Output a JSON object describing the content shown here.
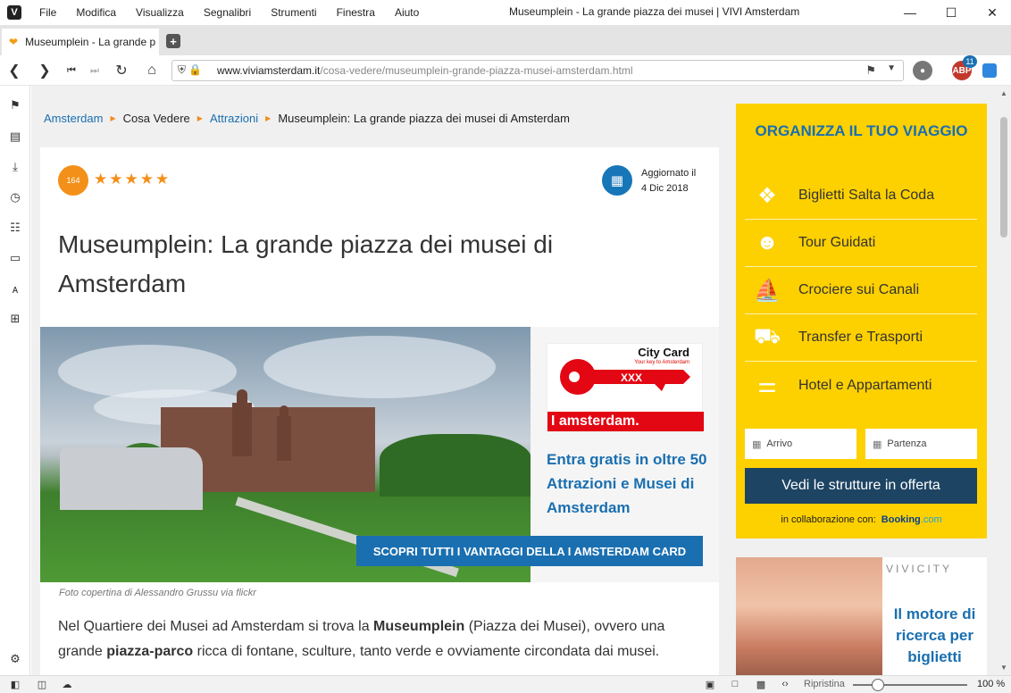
{
  "menubar": {
    "items": [
      "File",
      "Modifica",
      "Visualizza",
      "Segnalibri",
      "Strumenti",
      "Finestra",
      "Aiuto"
    ],
    "window_title": "Museumplein - La grande piazza dei musei | VIVI Amsterdam"
  },
  "tabs": [
    {
      "label": "Museumplein - La grande p"
    }
  ],
  "navbar": {
    "url_host": "www.viviamsterdam.it",
    "url_path": "/cosa-vedere/museumplein-grande-piazza-musei-amsterdam.html",
    "ext_badge_count": "11"
  },
  "breadcrumb": {
    "items": [
      "Amsterdam",
      "Cosa Vedere",
      "Attrazioni",
      "Museumplein: La grande piazza dei musei di Amsterdam"
    ]
  },
  "article": {
    "rating_count": "164",
    "stars": "★★★★★",
    "updated_label": "Aggiornato il",
    "updated_date": "4 Dic 2018",
    "title": "Museumplein: La grande piazza dei musei di Amsterdam",
    "photo_caption": "Foto copertina di Alessandro Grussu via flickr",
    "intro_1": "Nel Quartiere dei Musei ad Amsterdam si trova la ",
    "intro_b1": "Museumplein",
    "intro_2": " (Piazza dei Musei), ovvero una grande ",
    "intro_b2": "piazza-parco",
    "intro_3": " ricca di fontane, sculture, tanto verde e ovviamente circondata dai musei."
  },
  "citycard": {
    "title": "City Card",
    "subtitle": "Your key to Amsterdam",
    "key_text": "XXX",
    "brand_pre": "I am",
    "brand_post": "sterdam.",
    "promo": "Entra gratis in oltre 50 Attrazioni e Musei di Amsterdam",
    "cta": "SCOPRI TUTTI I VANTAGGI DELLA I AMSTERDAM CARD"
  },
  "widget": {
    "title": "ORGANIZZA IL TUO VIAGGIO",
    "items": [
      {
        "label": "Biglietti Salta la Coda",
        "icon": "ticket-icon"
      },
      {
        "label": "Tour Guidati",
        "icon": "group-icon"
      },
      {
        "label": "Crociere sui Canali",
        "icon": "boat-icon"
      },
      {
        "label": "Transfer e Trasporti",
        "icon": "taxi-icon"
      },
      {
        "label": "Hotel e Appartamenti",
        "icon": "bed-icon"
      }
    ],
    "arrival_placeholder": "Arrivo",
    "departure_placeholder": "Partenza",
    "submit_label": "Vedi le strutture in offerta",
    "collab_label": "in collaborazione con:",
    "booking_brand": "Booking",
    "booking_tld": ".com"
  },
  "ad": {
    "logo": "VIVICITY",
    "text": "Il motore di ricerca per biglietti"
  },
  "statusbar": {
    "reset_label": "Ripristina",
    "zoom": "100 %"
  },
  "colors": {
    "accent_blue": "#1a6fb0",
    "widget_yellow": "#fdd000",
    "rating_orange": "#f39019",
    "citycard_red": "#e30613"
  }
}
